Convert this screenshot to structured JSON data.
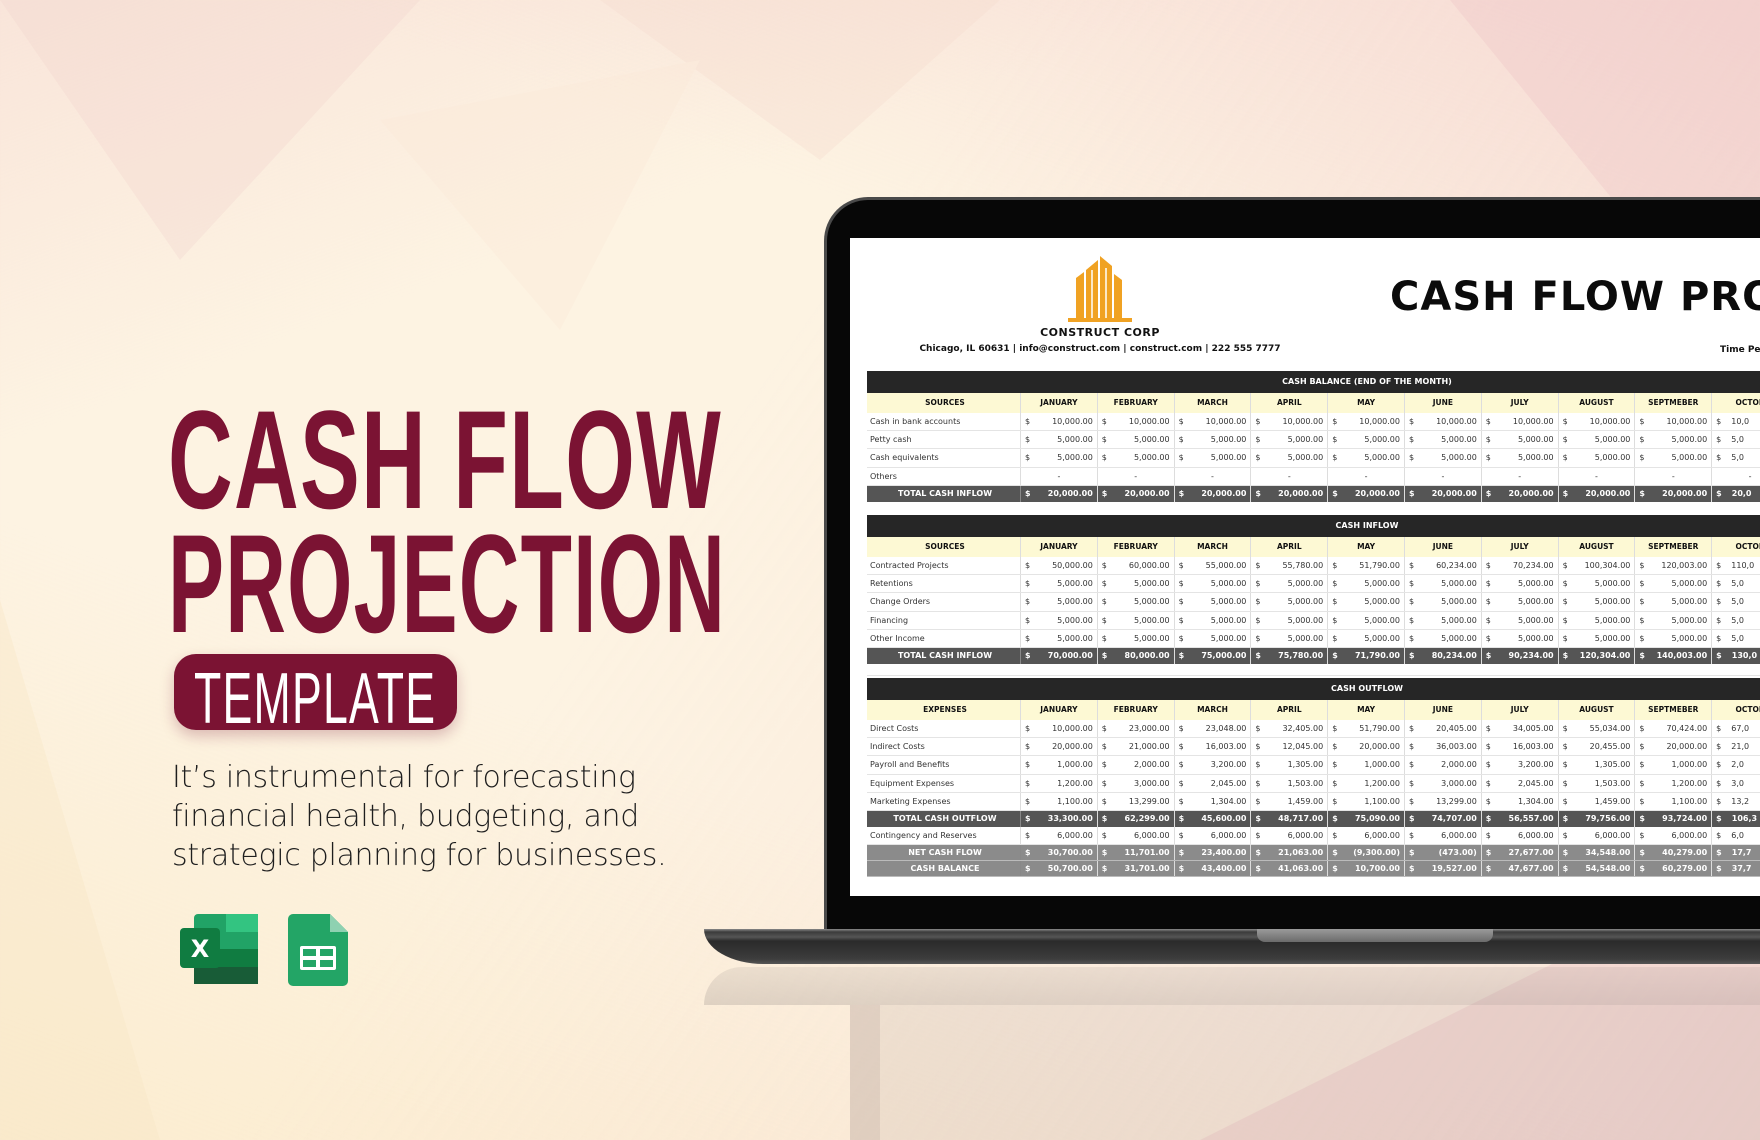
{
  "hero": {
    "title_line1": "CASH FLOW",
    "title_line2": "PROJECTION",
    "badge": "TEMPLATE",
    "description": "It’s instrumental for forecasting financial health, budgeting, and strategic planning for businesses.",
    "app_icons": [
      "excel-icon",
      "google-sheets-icon"
    ],
    "colors": {
      "accent": "#7b1333",
      "background": "#fdf3e2",
      "logo": "#f0a223"
    }
  },
  "sheet": {
    "company": "CONSTRUCT CORP",
    "contact": "Chicago, IL 60631   |   info@construct.com   |   construct.com   |   222 555 7777",
    "title": "CASH FLOW PROJEC",
    "time_period_label": "Time Peri",
    "months": [
      "JANUARY",
      "FEBRUARY",
      "MARCH",
      "APRIL",
      "MAY",
      "JUNE",
      "JULY",
      "AUGUST",
      "SEPTMEBER",
      "OCTOB"
    ],
    "sections": [
      {
        "title": "CASH BALANCE (END OF THE MONTH)",
        "first_col": "SOURCES",
        "rows": [
          {
            "label": "Cash in bank accounts",
            "values": [
              "10,000.00",
              "10,000.00",
              "10,000.00",
              "10,000.00",
              "10,000.00",
              "10,000.00",
              "10,000.00",
              "10,000.00",
              "10,000.00",
              "10,0"
            ]
          },
          {
            "label": "Petty cash",
            "values": [
              "5,000.00",
              "5,000.00",
              "5,000.00",
              "5,000.00",
              "5,000.00",
              "5,000.00",
              "5,000.00",
              "5,000.00",
              "5,000.00",
              "5,0"
            ]
          },
          {
            "label": "Cash equivalents",
            "values": [
              "5,000.00",
              "5,000.00",
              "5,000.00",
              "5,000.00",
              "5,000.00",
              "5,000.00",
              "5,000.00",
              "5,000.00",
              "5,000.00",
              "5,0"
            ]
          },
          {
            "label": "Others",
            "values": [
              "-",
              "-",
              "-",
              "-",
              "-",
              "-",
              "-",
              "-",
              "-",
              "-"
            ]
          }
        ],
        "totals": [
          {
            "label": "TOTAL CASH INFLOW",
            "values": [
              "20,000.00",
              "20,000.00",
              "20,000.00",
              "20,000.00",
              "20,000.00",
              "20,000.00",
              "20,000.00",
              "20,000.00",
              "20,000.00",
              "20,0"
            ]
          }
        ]
      },
      {
        "title": "CASH INFLOW",
        "first_col": "SOURCES",
        "rows": [
          {
            "label": "Contracted Projects",
            "values": [
              "50,000.00",
              "60,000.00",
              "55,000.00",
              "55,780.00",
              "51,790.00",
              "60,234.00",
              "70,234.00",
              "100,304.00",
              "120,003.00",
              "110,0"
            ]
          },
          {
            "label": "Retentions",
            "values": [
              "5,000.00",
              "5,000.00",
              "5,000.00",
              "5,000.00",
              "5,000.00",
              "5,000.00",
              "5,000.00",
              "5,000.00",
              "5,000.00",
              "5,0"
            ]
          },
          {
            "label": "Change Orders",
            "values": [
              "5,000.00",
              "5,000.00",
              "5,000.00",
              "5,000.00",
              "5,000.00",
              "5,000.00",
              "5,000.00",
              "5,000.00",
              "5,000.00",
              "5,0"
            ]
          },
          {
            "label": "Financing",
            "values": [
              "5,000.00",
              "5,000.00",
              "5,000.00",
              "5,000.00",
              "5,000.00",
              "5,000.00",
              "5,000.00",
              "5,000.00",
              "5,000.00",
              "5,0"
            ]
          },
          {
            "label": "Other Income",
            "values": [
              "5,000.00",
              "5,000.00",
              "5,000.00",
              "5,000.00",
              "5,000.00",
              "5,000.00",
              "5,000.00",
              "5,000.00",
              "5,000.00",
              "5,0"
            ]
          }
        ],
        "totals": [
          {
            "label": "TOTAL CASH INFLOW",
            "values": [
              "70,000.00",
              "80,000.00",
              "75,000.00",
              "75,780.00",
              "71,790.00",
              "80,234.00",
              "90,234.00",
              "120,304.00",
              "140,003.00",
              "130,0"
            ]
          }
        ]
      },
      {
        "title": "CASH OUTFLOW",
        "first_col": "EXPENSES",
        "rows": [
          {
            "label": "Direct Costs",
            "values": [
              "10,000.00",
              "23,000.00",
              "23,048.00",
              "32,405.00",
              "51,790.00",
              "20,405.00",
              "34,005.00",
              "55,034.00",
              "70,424.00",
              "67,0"
            ]
          },
          {
            "label": "Indirect Costs",
            "values": [
              "20,000.00",
              "21,000.00",
              "16,003.00",
              "12,045.00",
              "20,000.00",
              "36,003.00",
              "16,003.00",
              "20,455.00",
              "20,000.00",
              "21,0"
            ]
          },
          {
            "label": "Payroll and Benefits",
            "values": [
              "1,000.00",
              "2,000.00",
              "3,200.00",
              "1,305.00",
              "1,000.00",
              "2,000.00",
              "3,200.00",
              "1,305.00",
              "1,000.00",
              "2,0"
            ]
          },
          {
            "label": "Equipment Expenses",
            "values": [
              "1,200.00",
              "3,000.00",
              "2,045.00",
              "1,503.00",
              "1,200.00",
              "3,000.00",
              "2,045.00",
              "1,503.00",
              "1,200.00",
              "3,0"
            ]
          },
          {
            "label": "Marketing Expenses",
            "values": [
              "1,100.00",
              "13,299.00",
              "1,304.00",
              "1,459.00",
              "1,100.00",
              "13,299.00",
              "1,304.00",
              "1,459.00",
              "1,100.00",
              "13,2"
            ]
          }
        ],
        "totals": [
          {
            "label": "TOTAL CASH OUTFLOW",
            "values": [
              "33,300.00",
              "62,299.00",
              "45,600.00",
              "48,717.00",
              "75,090.00",
              "74,707.00",
              "56,557.00",
              "79,756.00",
              "93,724.00",
              "106,3"
            ]
          },
          {
            "label": "Contingency and Reserves",
            "plain": true,
            "values": [
              "6,000.00",
              "6,000.00",
              "6,000.00",
              "6,000.00",
              "6,000.00",
              "6,000.00",
              "6,000.00",
              "6,000.00",
              "6,000.00",
              "6,0"
            ]
          },
          {
            "label": "NET CASH FLOW",
            "grey": true,
            "values": [
              "30,700.00",
              "11,701.00",
              "23,400.00",
              "21,063.00",
              "(9,300.00)",
              "(473.00)",
              "27,677.00",
              "34,548.00",
              "40,279.00",
              "17,7"
            ]
          },
          {
            "label": "CASH BALANCE",
            "grey": true,
            "values": [
              "50,700.00",
              "31,701.00",
              "43,400.00",
              "41,063.00",
              "10,700.00",
              "19,527.00",
              "47,677.00",
              "54,548.00",
              "60,279.00",
              "37,7"
            ]
          }
        ]
      }
    ]
  }
}
